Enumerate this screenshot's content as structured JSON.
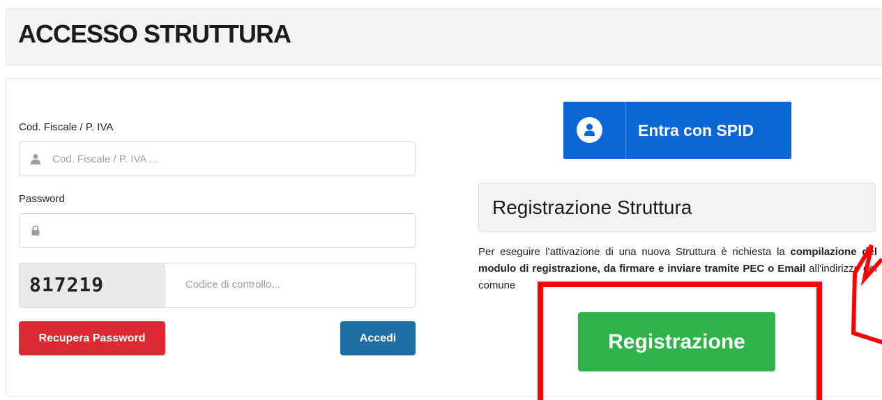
{
  "page": {
    "title": "ACCESSO STRUTTURA"
  },
  "login": {
    "cf_label": "Cod. Fiscale / P. IVA",
    "cf_placeholder": "Cod. Fiscale / P. IVA ...",
    "cf_icon": "user-icon",
    "password_label": "Password",
    "password_icon": "lock-icon",
    "captcha_text": "817219",
    "captcha_placeholder": "Codice di controllo...",
    "recover_label": "Recupera Password",
    "login_label": "Accedi"
  },
  "spid": {
    "label": "Entra con SPID",
    "icon": "spid-user-icon"
  },
  "registration": {
    "title": "Registrazione Struttura",
    "text_part1": "Per eseguire l'attivazione di una nuova Struttura è richiesta la ",
    "text_bold": "compilazione del modulo di registrazione, da firmare e inviare tramite PEC o Email",
    "text_part2": " all'indirizzo del comune",
    "button_label": "Registrazione"
  },
  "colors": {
    "recover_button": "#dc2a33",
    "login_button": "#1f6fa6",
    "spid_button": "#0b66d6",
    "register_button": "#2db34a",
    "annotation_red": "#ff0000"
  }
}
